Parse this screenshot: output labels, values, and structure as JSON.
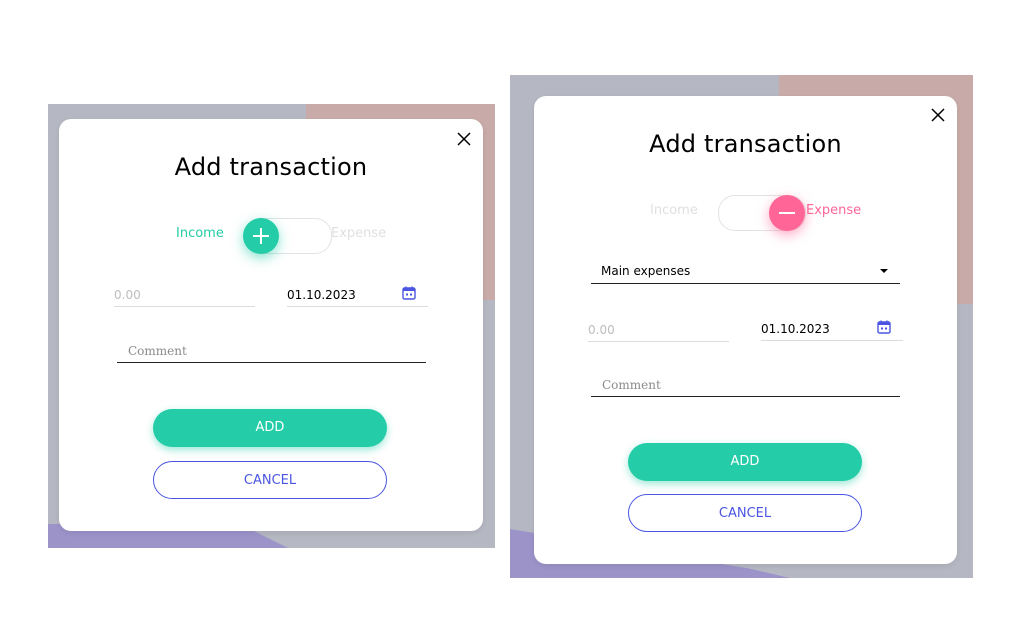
{
  "colors": {
    "income_green": "#24cca7",
    "expense_pink": "#ff6596",
    "cancel_blue": "#4a56e2",
    "inactive_label": "#e0e0e0"
  },
  "left_modal": {
    "title": "Add transaction",
    "toggle": {
      "income_label": "Income",
      "expense_label": "Expense",
      "state": "income",
      "knob_icon": "plus-icon"
    },
    "amount_placeholder": "0.00",
    "date_value": "01.10.2023",
    "comment_placeholder": "Comment",
    "add_label": "ADD",
    "cancel_label": "CANCEL"
  },
  "right_modal": {
    "title": "Add transaction",
    "toggle": {
      "income_label": "Income",
      "expense_label": "Expense",
      "state": "expense",
      "knob_icon": "minus-icon"
    },
    "category_value": "Main expenses",
    "amount_placeholder": "0.00",
    "date_value": "01.10.2023",
    "comment_placeholder": "Comment",
    "add_label": "ADD",
    "cancel_label": "CANCEL"
  }
}
